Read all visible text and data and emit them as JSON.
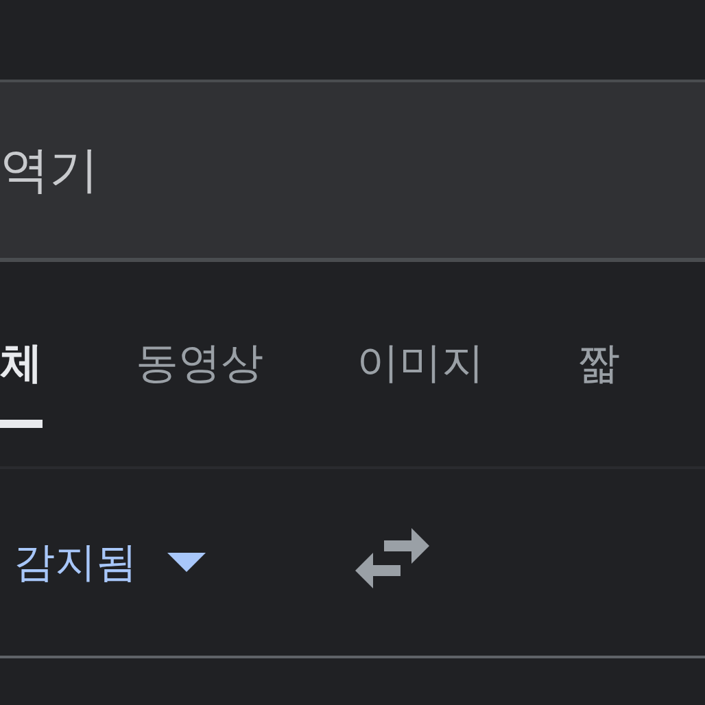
{
  "search": {
    "value": "역기"
  },
  "tabs": [
    {
      "label": "체",
      "selected": true
    },
    {
      "label": "동영상",
      "selected": false
    },
    {
      "label": "이미지",
      "selected": false
    },
    {
      "label": "짧",
      "selected": false
    }
  ],
  "translate": {
    "source_language": "감지됨"
  }
}
